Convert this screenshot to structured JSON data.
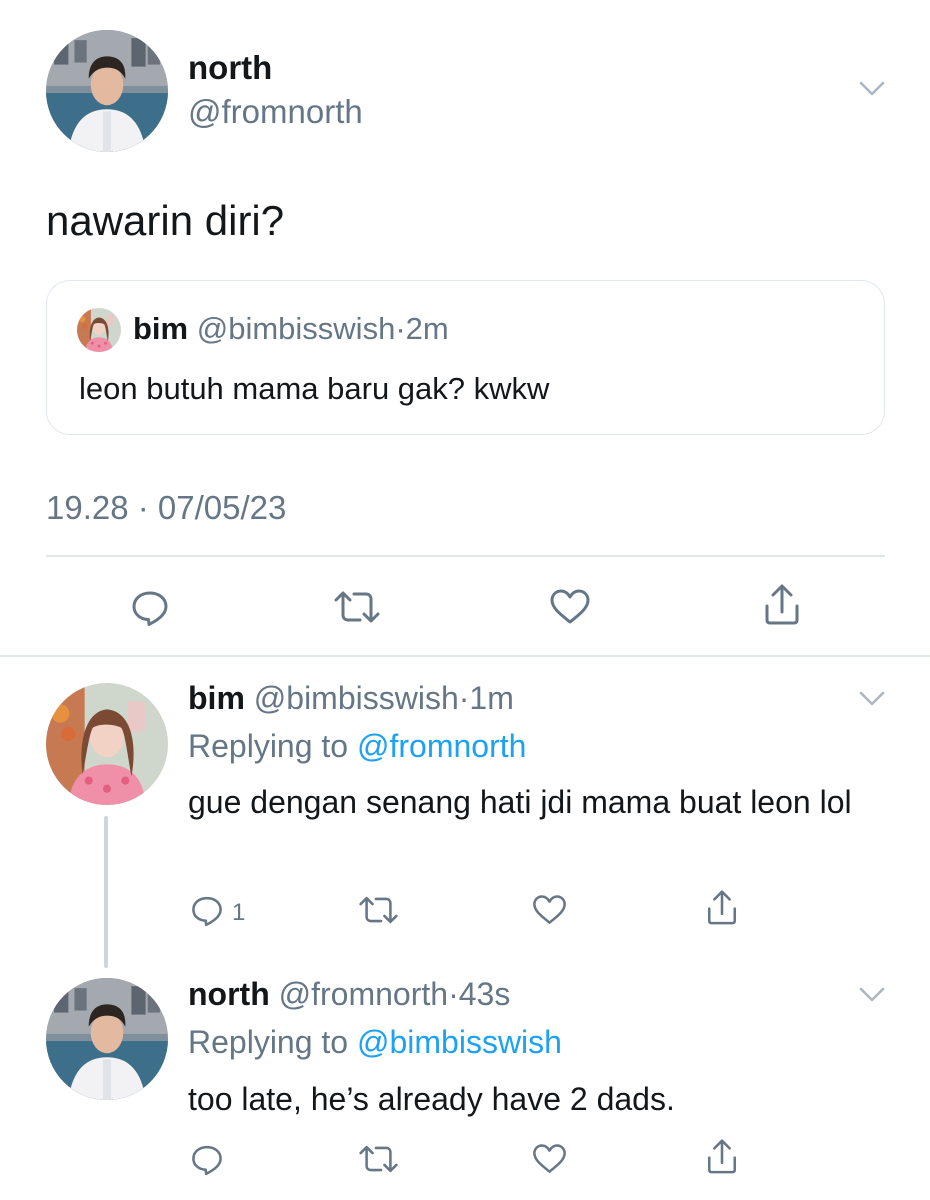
{
  "main_tweet": {
    "name": "north",
    "handle": "@fromnorth",
    "text": "nawarin diri?",
    "quote": {
      "name": "bim",
      "handle": "@bimbisswish",
      "separator": "·",
      "time": "2m",
      "text": "leon butuh mama baru gak? kwkw"
    },
    "timestamp": "19.28 · 07/05/23"
  },
  "replies": [
    {
      "name": "bim",
      "handle": "@bimbisswish",
      "separator": "·",
      "time": "1m",
      "replying_prefix": "Replying to ",
      "replying_to": "@fromnorth",
      "text": "gue dengan senang hati jdi mama buat leon lol",
      "reply_count": "1"
    },
    {
      "name": "north",
      "handle": "@fromnorth",
      "separator": "·",
      "time": "43s",
      "replying_prefix": "Replying to ",
      "replying_to": "@bimbisswish",
      "text": "too late, he’s already have 2 dads.",
      "reply_count": ""
    }
  ],
  "icons": [
    "chevron-down-icon",
    "reply-icon",
    "retweet-icon",
    "like-icon",
    "share-icon"
  ],
  "colors": {
    "text": "#14171a",
    "secondary": "#657786",
    "link": "#1da1f2",
    "border": "#e1e8ed",
    "thread_line": "#ccd6dd"
  }
}
